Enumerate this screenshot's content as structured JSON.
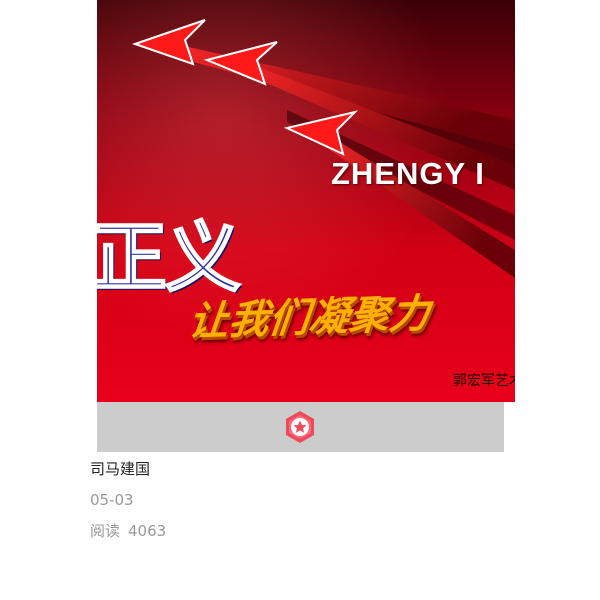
{
  "poster": {
    "english_title": "ZHENGY I",
    "chinese_title": "正义",
    "slogan": "让我们凝聚力",
    "signature": "郭宏军艺术"
  },
  "badge": {
    "icon": "star-badge-icon",
    "color": "#ef4a5a"
  },
  "article": {
    "author": "司马建国",
    "date": "05-03",
    "reads_label": "阅读",
    "reads_count": "4063"
  },
  "colors": {
    "poster_red": "#e8001a",
    "bar_grey": "#cccccc",
    "meta_text": "#999999"
  }
}
